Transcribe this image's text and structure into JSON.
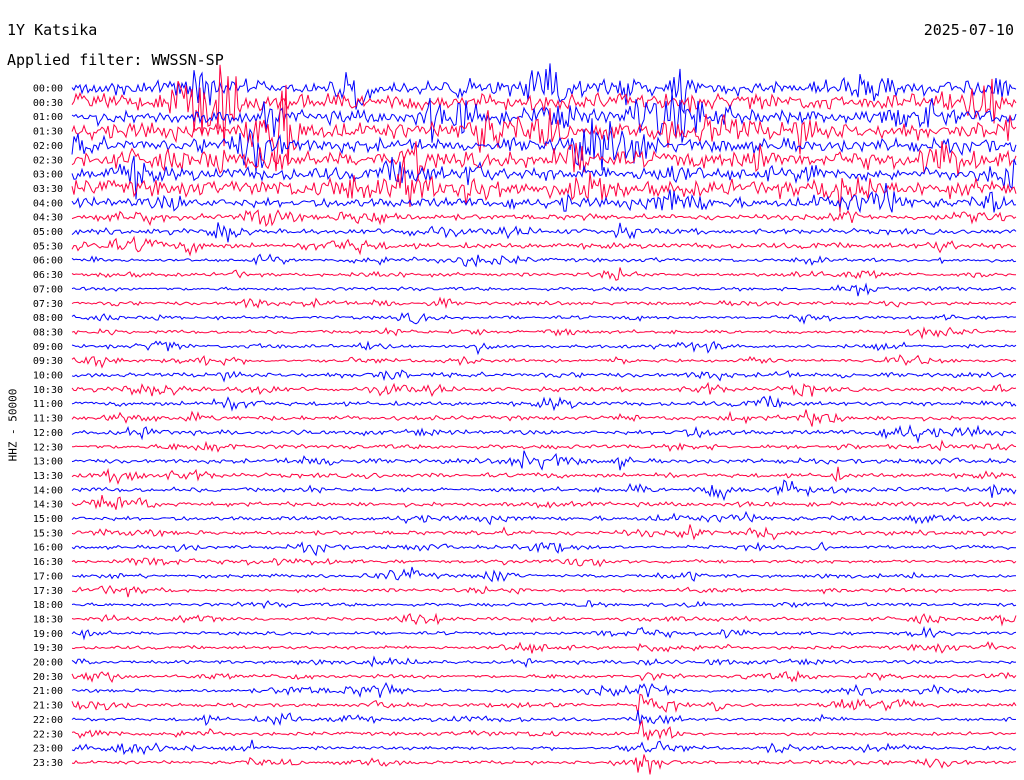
{
  "header": {
    "station": "1Y Katsika",
    "date": "2025-07-10",
    "filter": "Applied filter: WWSSN-SP"
  },
  "chart_data": {
    "type": "line",
    "title": "1Y Katsika",
    "ylabel": "HHZ - 50000",
    "row_times": [
      "00:00",
      "00:30",
      "01:00",
      "01:30",
      "02:00",
      "02:30",
      "03:00",
      "03:30",
      "04:00",
      "04:30",
      "05:00",
      "05:30",
      "06:00",
      "06:30",
      "07:00",
      "07:30",
      "08:00",
      "08:30",
      "09:00",
      "09:30",
      "10:00",
      "10:30",
      "11:00",
      "11:30",
      "12:00",
      "12:30",
      "13:00",
      "13:30",
      "14:00",
      "14:30",
      "15:00",
      "15:30",
      "16:00",
      "16:30",
      "17:00",
      "17:30",
      "18:00",
      "18:30",
      "19:00",
      "19:30",
      "20:00",
      "20:30",
      "21:00",
      "21:30",
      "22:00",
      "22:30",
      "23:00",
      "23:30"
    ],
    "trace_colors": [
      "#0000ff",
      "#ff0040"
    ],
    "rows_per_hour": 2,
    "minutes_per_row": 30,
    "grid": false,
    "legend": "none"
  }
}
